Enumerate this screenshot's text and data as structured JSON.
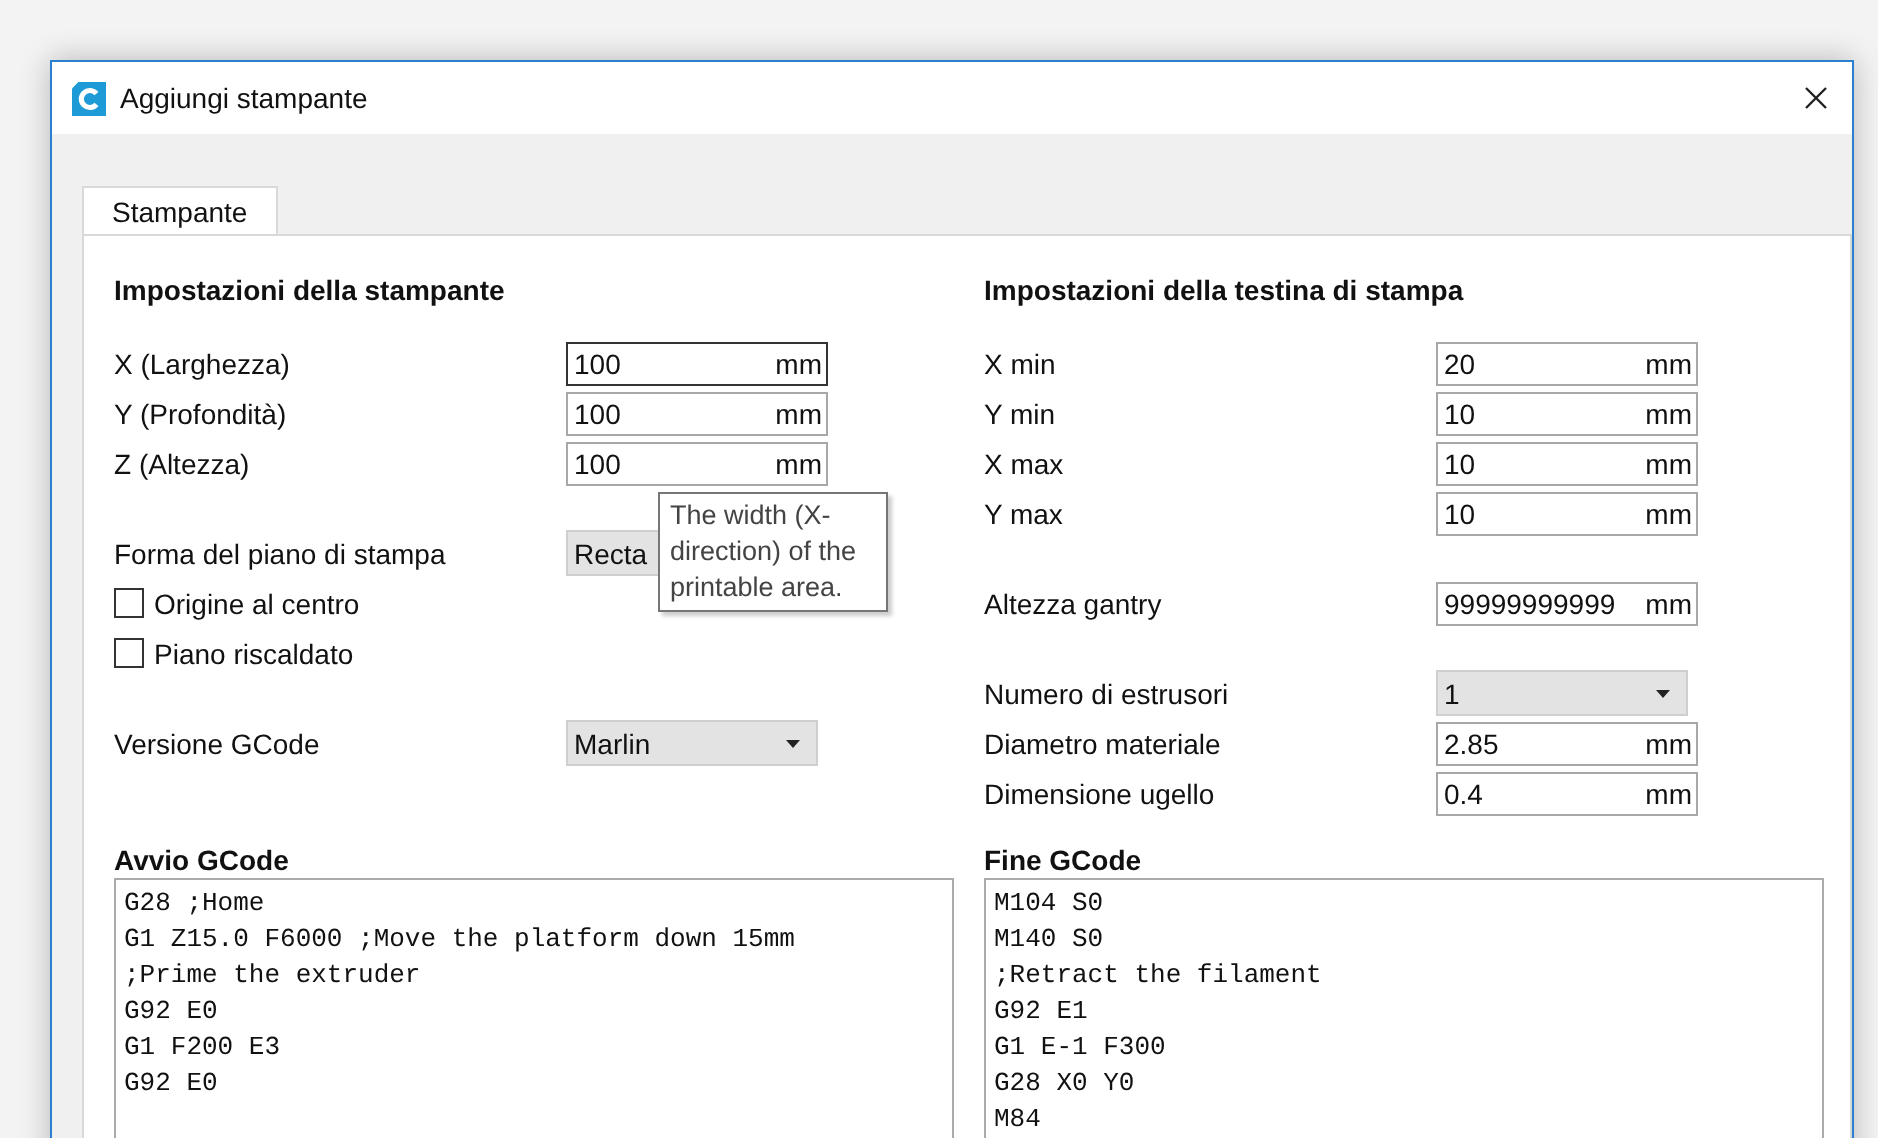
{
  "window": {
    "title": "Aggiungi stampante"
  },
  "tabs": [
    {
      "label": "Stampante",
      "selected": true
    }
  ],
  "printer_settings": {
    "heading": "Impostazioni della stampante",
    "groups": [
      [
        {
          "kind": "field",
          "label": "X (Larghezza)",
          "value": "100",
          "unit": "mm",
          "focused": true
        },
        {
          "kind": "field",
          "label": "Y (Profondità)",
          "value": "100",
          "unit": "mm",
          "focused": false
        },
        {
          "kind": "field",
          "label": "Z (Altezza)",
          "value": "100",
          "unit": "mm",
          "focused": false
        }
      ],
      [
        {
          "kind": "combo",
          "label": "Forma del piano di stampa",
          "value": "Recta"
        },
        {
          "kind": "checkbox",
          "label": "Origine al centro",
          "checked": false
        },
        {
          "kind": "checkbox",
          "label": "Piano riscaldato",
          "checked": false
        }
      ],
      [
        {
          "kind": "combo",
          "label": "Versione GCode",
          "value": "Marlin"
        }
      ]
    ]
  },
  "printhead_settings": {
    "heading": "Impostazioni della testina di stampa",
    "groups": [
      [
        {
          "kind": "field",
          "label": "X min",
          "value": "20",
          "unit": "mm",
          "focused": false
        },
        {
          "kind": "field",
          "label": "Y min",
          "value": "10",
          "unit": "mm",
          "focused": false
        },
        {
          "kind": "field",
          "label": "X max",
          "value": "10",
          "unit": "mm",
          "focused": false
        },
        {
          "kind": "field",
          "label": "Y max",
          "value": "10",
          "unit": "mm",
          "focused": false
        }
      ],
      [
        {
          "kind": "field",
          "label": "Altezza gantry",
          "value": "99999999999",
          "unit": "mm",
          "focused": false
        }
      ],
      [
        {
          "kind": "combo",
          "label": "Numero di estrusori",
          "value": "1"
        },
        {
          "kind": "field",
          "label": "Diametro materiale",
          "value": "2.85",
          "unit": "mm",
          "focused": false
        },
        {
          "kind": "field",
          "label": "Dimensione ugello",
          "value": "0.4",
          "unit": "mm",
          "focused": false
        }
      ]
    ]
  },
  "start_gcode": {
    "heading": "Avvio GCode",
    "lines": [
      "G28 ;Home",
      "G1 Z15.0 F6000 ;Move the platform down 15mm",
      ";Prime the extruder",
      "G92 E0",
      "G1 F200 E3",
      "G92 E0"
    ]
  },
  "end_gcode": {
    "heading": "Fine GCode",
    "lines": [
      "M104 S0",
      "M140 S0",
      ";Retract the filament",
      "G92 E1",
      "G1 E-1 F300",
      "G28 X0 Y0",
      "M84"
    ]
  },
  "tooltip": {
    "text": "The width (X-direction) of the printable area."
  }
}
